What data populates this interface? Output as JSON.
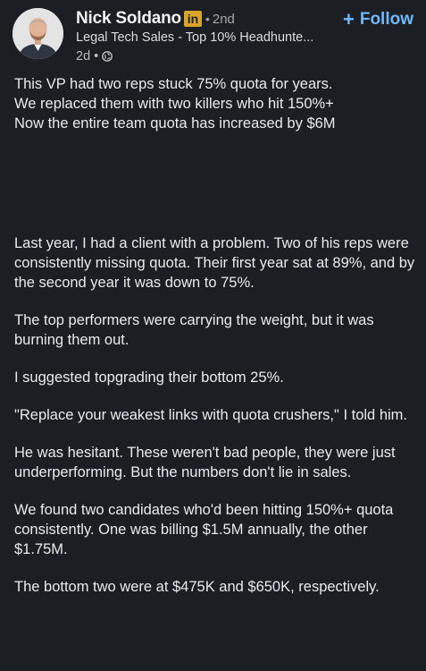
{
  "author": {
    "name": "Nick Soldano",
    "badge": "in",
    "separator": "•",
    "degree": "2nd",
    "headline": "Legal Tech Sales - Top 10% Headhunte...",
    "time": "2d",
    "meta_separator": "•",
    "visibility_icon": "globe-icon"
  },
  "follow": {
    "plus": "+",
    "label": "Follow"
  },
  "colors": {
    "background": "#1b1f23",
    "text": "#eaeaea",
    "accent": "#71b7fb",
    "badge": "#d9a42a"
  },
  "post": {
    "intro": [
      "This VP had two reps stuck 75% quota for years.",
      "We replaced them with two killers who hit 150%+",
      "Now the entire team quota has increased by $6M"
    ],
    "paragraphs": [
      "Last year, I had a client with a problem. Two of his reps were consistently missing quota. Their first year sat at 89%, and by the second year it was down to 75%.",
      "The top performers were carrying the weight, but it was burning them out.",
      "I suggested topgrading their bottom 25%.",
      "\"Replace your weakest links with quota crushers,\" I told him.",
      "He was hesitant. These weren't bad people, they were just underperforming. But the numbers don't lie in sales.",
      "We found two candidates who'd been hitting 150%+ quota consistently. One was billing $1.5M annually, the other $1.75M.",
      "The bottom two were at $475K and $650K, respectively."
    ]
  }
}
